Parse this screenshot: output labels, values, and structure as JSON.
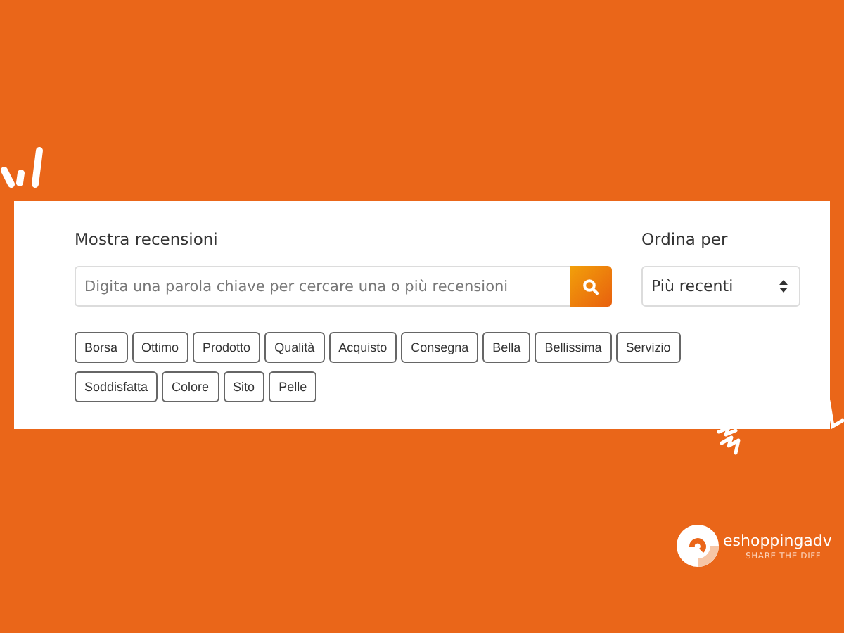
{
  "search_panel": {
    "label": "Mostra recensioni",
    "search": {
      "placeholder": "Digita una parola chiave per cercare una o più recensioni"
    },
    "tags": [
      "Borsa",
      "Ottimo",
      "Prodotto",
      "Qualità",
      "Acquisto",
      "Consegna",
      "Bella",
      "Bellissima",
      "Servizio",
      "Soddisfatta",
      "Colore",
      "Sito",
      "Pelle"
    ]
  },
  "sort": {
    "label": "Ordina per",
    "value": "Più recenti"
  },
  "logo": {
    "name": "eshoppingadv",
    "tagline": "SHARE THE DIFF"
  }
}
